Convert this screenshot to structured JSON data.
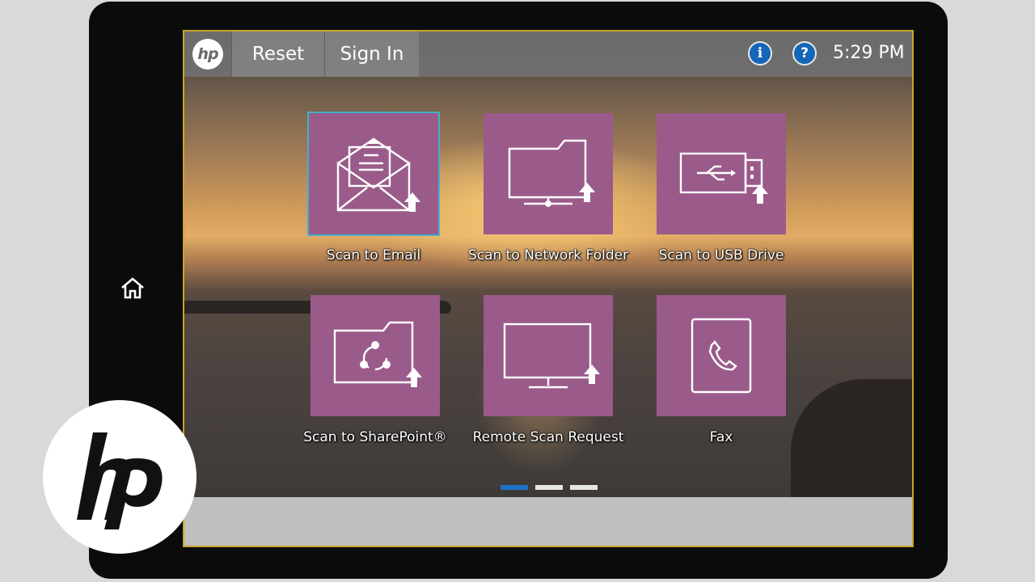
{
  "topbar": {
    "logo_text": "hp",
    "reset_label": "Reset",
    "signin_label": "Sign In",
    "info_icon": "i",
    "help_icon": "?",
    "time": "5:29 PM"
  },
  "tiles": [
    {
      "label": "Scan to Email",
      "icon": "envelope-upload-icon"
    },
    {
      "label": "Scan to Network Folder",
      "icon": "network-folder-upload-icon"
    },
    {
      "label": "Scan to USB Drive",
      "icon": "usb-drive-upload-icon"
    },
    {
      "label": "Scan to SharePoint®",
      "icon": "sharepoint-folder-upload-icon"
    },
    {
      "label": "Remote Scan Request",
      "icon": "monitor-upload-icon"
    },
    {
      "label": "Fax",
      "icon": "phone-icon"
    }
  ],
  "pagination": {
    "pages": 3,
    "current": 1
  },
  "watermark": {
    "brand": "hp"
  },
  "colors": {
    "tile": "#9a5b8a",
    "active_dot": "#1f73c6",
    "info_blue": "#1466b8",
    "selection": "#45b0c8"
  }
}
